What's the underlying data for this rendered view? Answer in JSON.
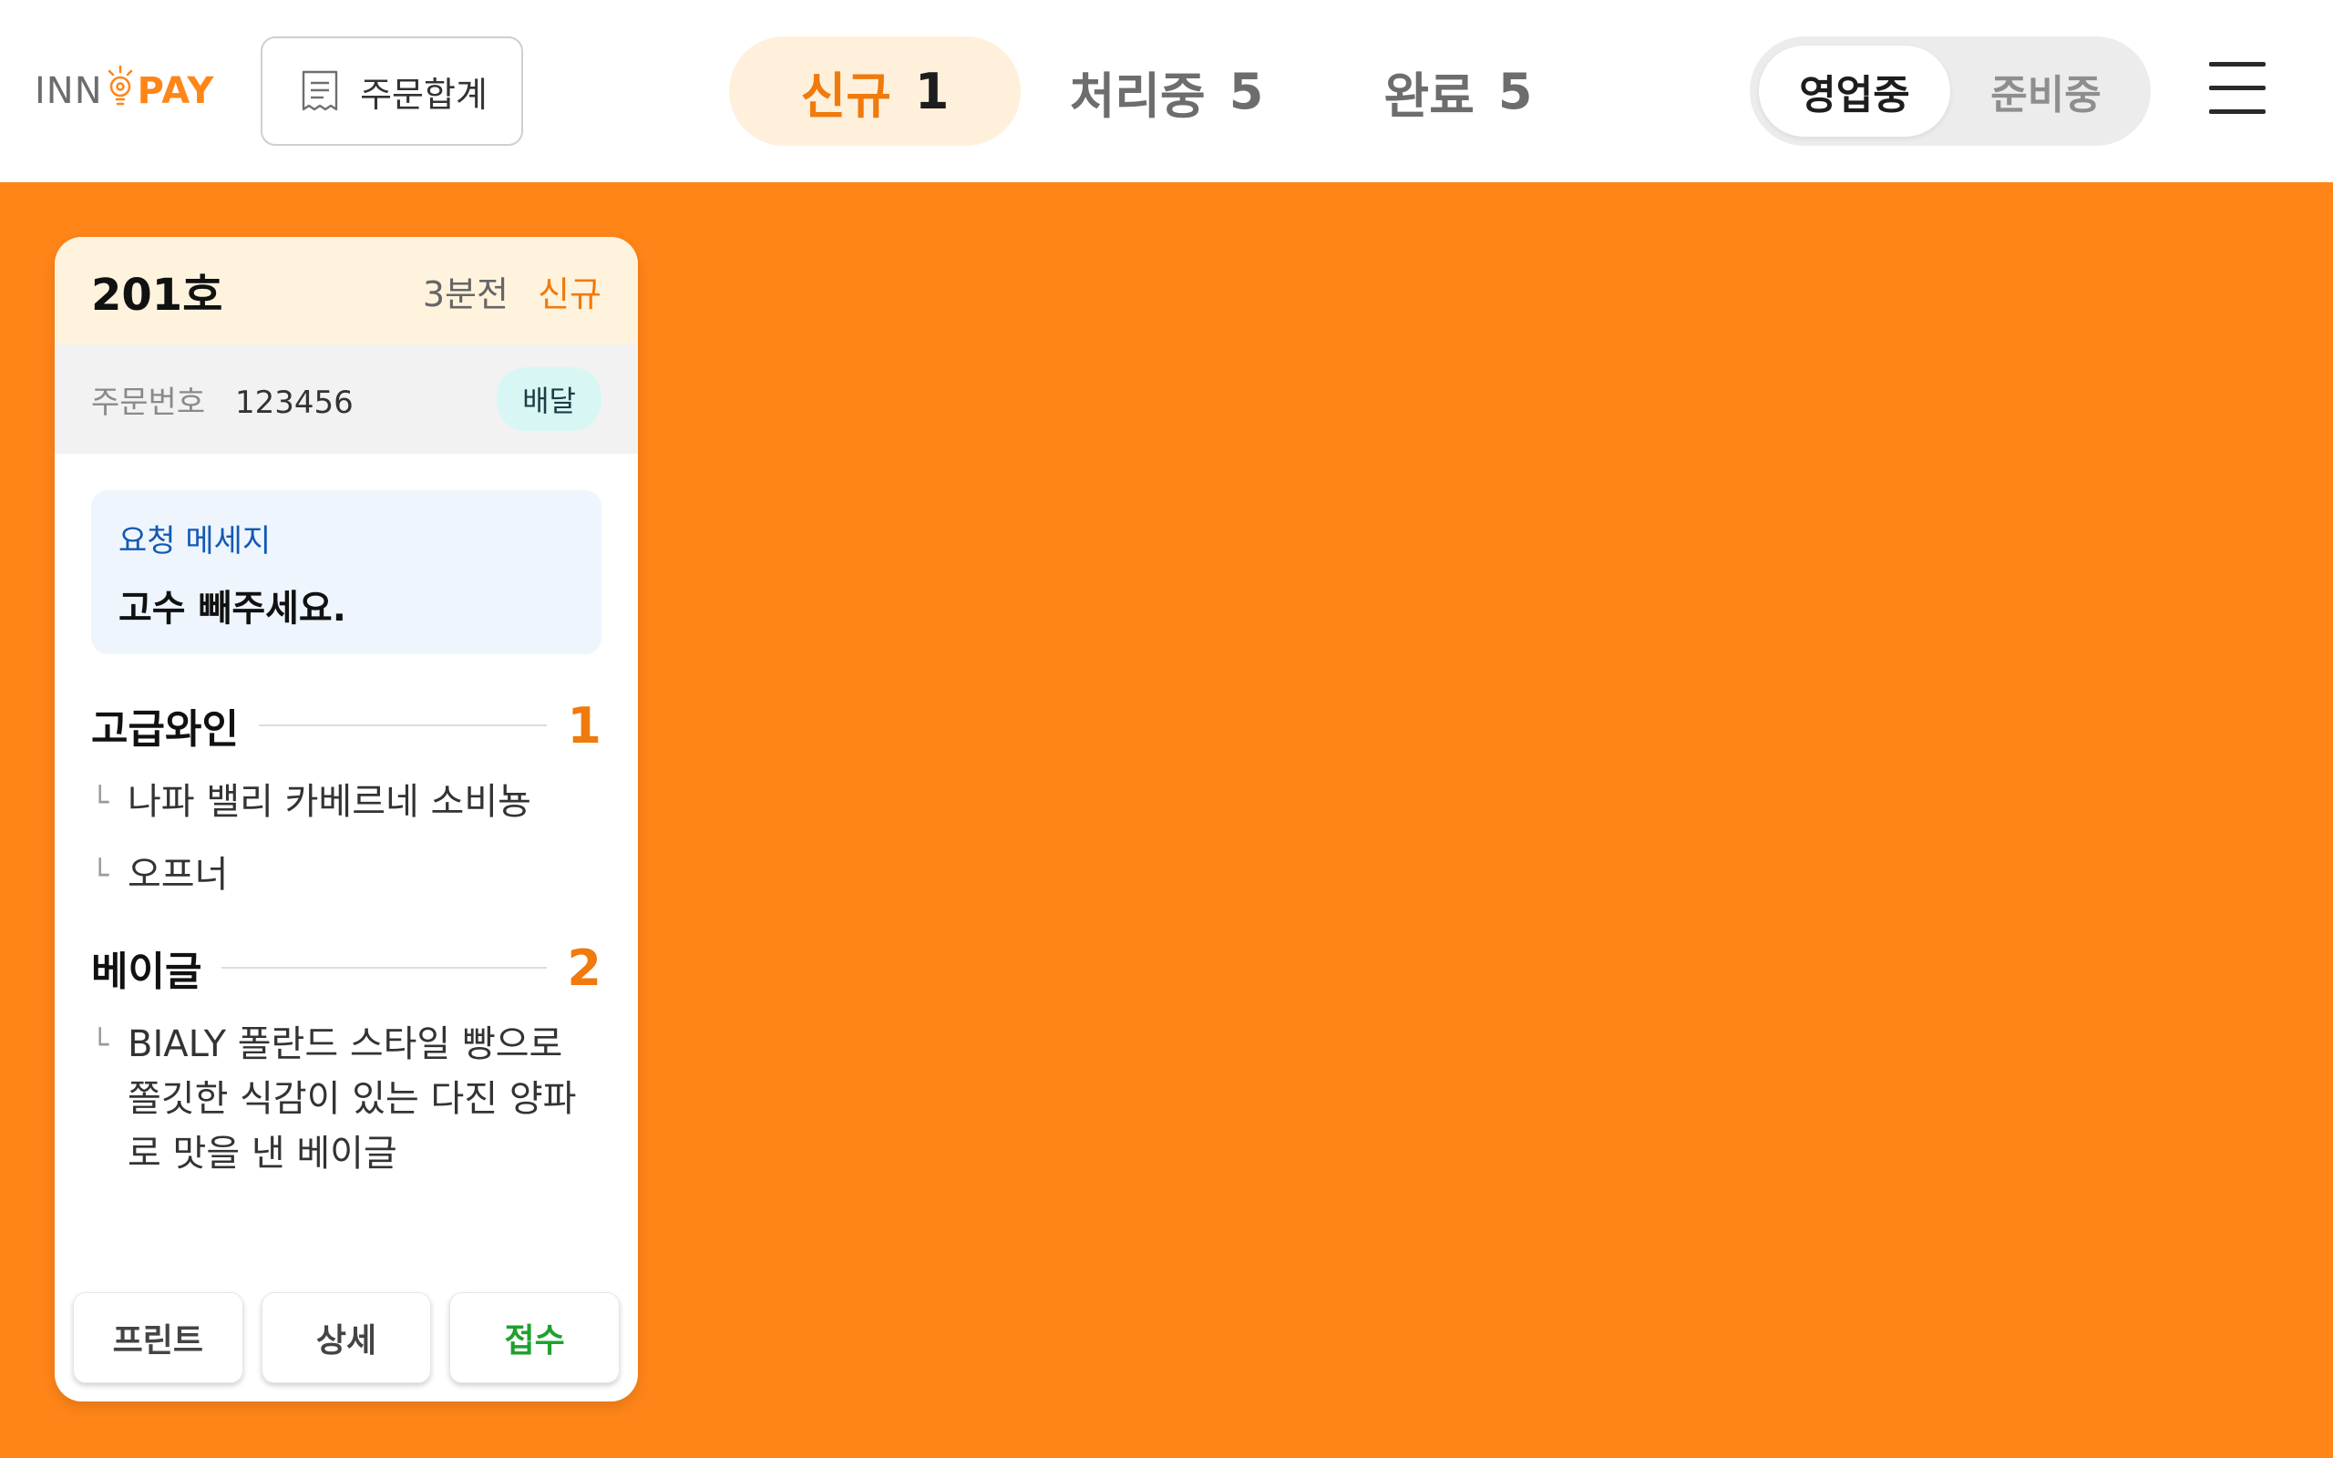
{
  "header": {
    "logo": {
      "left": "INN",
      "right": "PAY"
    },
    "order_sum_label": "주문합계",
    "tabs": [
      {
        "label": "신규",
        "count": "1",
        "active": true
      },
      {
        "label": "처리중",
        "count": "5",
        "active": false
      },
      {
        "label": "완료",
        "count": "5",
        "active": false
      }
    ],
    "status": {
      "open_label": "영업중",
      "prep_label": "준비중",
      "selected": "영업중"
    }
  },
  "colors": {
    "accent": "#ff8518",
    "accent_text": "#f07a0b",
    "accept": "#1fa12c"
  },
  "order": {
    "room": "201호",
    "time_ago": "3분전",
    "state": "신규",
    "order_no_label": "주문번호",
    "order_no": "123456",
    "type_badge": "배달",
    "request_title": "요청 메세지",
    "request_message": "고수 빼주세요.",
    "items": [
      {
        "name": "고급와인",
        "qty": "1",
        "options": [
          "나파 밸리 카베르네 소비뇽",
          "오프너"
        ]
      },
      {
        "name": "베이글",
        "qty": "2",
        "options": [
          "BIALY 폴란드 스타일 빵으로 쫄깃한 식감이 있는 다진 양파로 맛을 낸 베이글"
        ]
      }
    ],
    "actions": {
      "print": "프린트",
      "detail": "상세",
      "accept": "접수"
    }
  }
}
